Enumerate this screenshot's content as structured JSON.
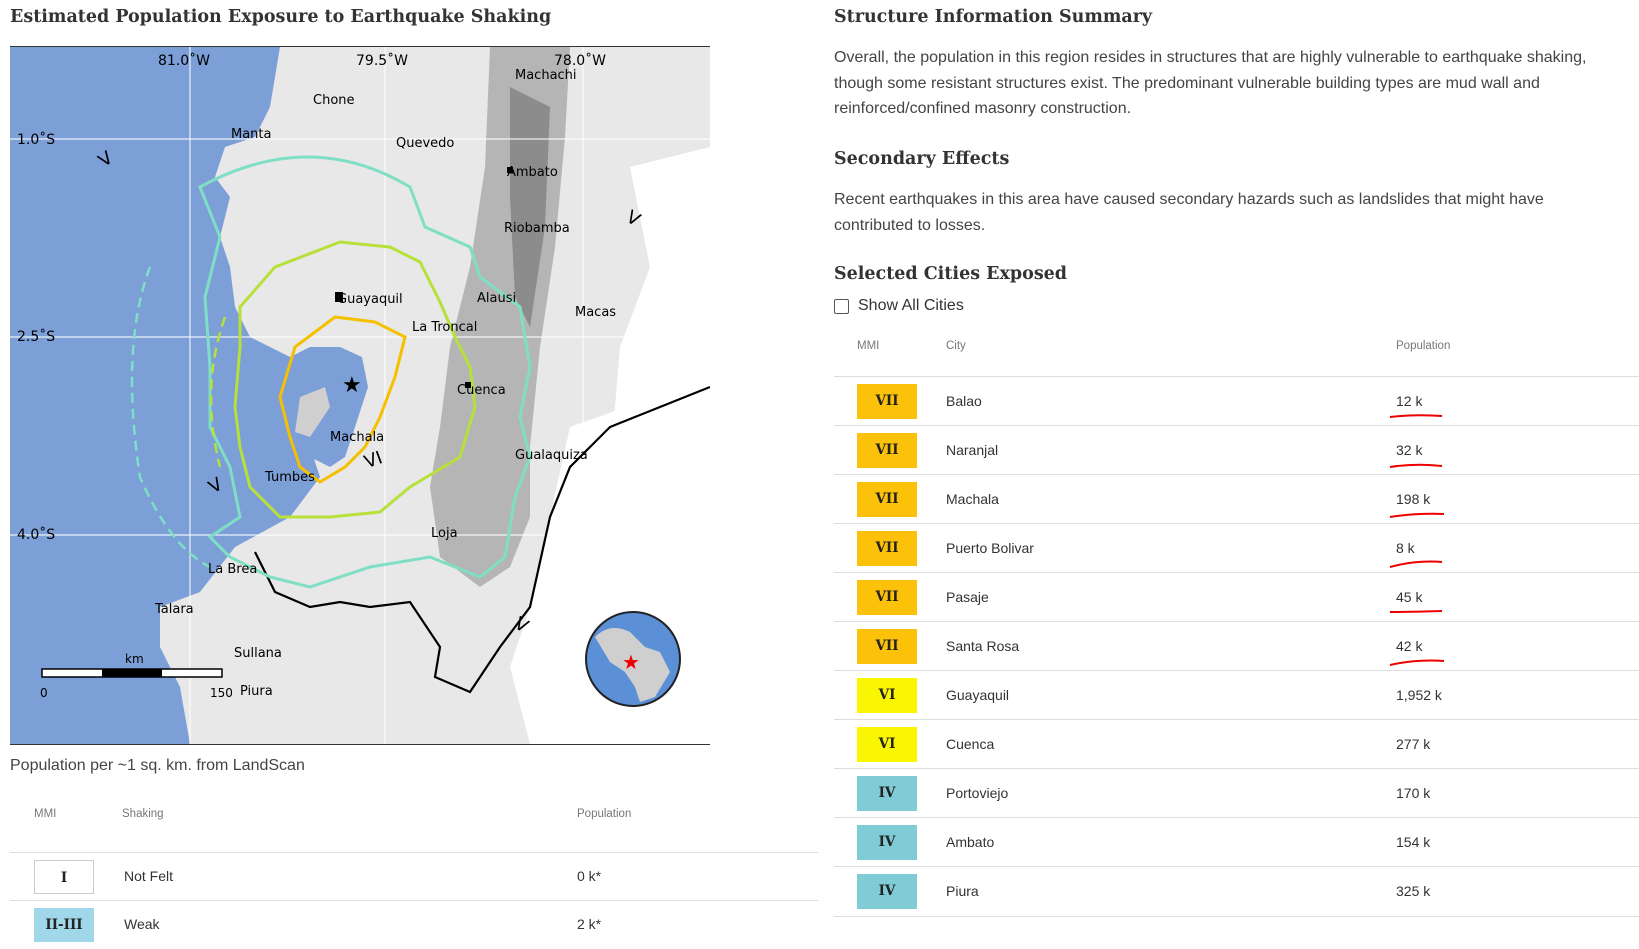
{
  "map_section": {
    "title": "Estimated Population Exposure to Earthquake Shaking",
    "caption": "Population per ~1 sq. km. from LandScan",
    "lon_labels": [
      "81.0˚W",
      "79.5˚W",
      "78.0˚W"
    ],
    "lat_labels": [
      "1.0˚S",
      "2.5˚S",
      "4.0˚S"
    ],
    "places": [
      "Machachi",
      "Chone",
      "Manta",
      "Quevedo",
      "Ambato",
      "Riobamba",
      "Guayaquil",
      "Alausi",
      "Macas",
      "La Troncal",
      "Cuenca",
      "Machala",
      "Gualaquiza",
      "Tumbes",
      "Loja",
      "La Brea",
      "Talara",
      "Sullana",
      "Piura"
    ],
    "contour_labels": [
      "V",
      "V",
      "V",
      "V",
      "VI"
    ],
    "scale": {
      "unit": "km",
      "start": "0",
      "end": "150"
    }
  },
  "shaking_table": {
    "headers": {
      "mmi": "MMI",
      "shaking": "Shaking",
      "population": "Population"
    },
    "rows": [
      {
        "mmi": "I",
        "shaking": "Not Felt",
        "population": "0 k*",
        "color": "#ffffff"
      },
      {
        "mmi": "II-III",
        "shaking": "Weak",
        "population": "2 k*",
        "color": "#a0d8ea"
      }
    ]
  },
  "structure": {
    "title": "Structure Information Summary",
    "text_lines": [
      "Overall, the population in this region resides in structures that are highly vulnerable to earthquake shaking,",
      "though some resistant structures exist. The predominant vulnerable building types are mud wall and",
      "reinforced/confined masonry construction."
    ]
  },
  "secondary": {
    "title": "Secondary Effects",
    "text_lines": [
      "Recent earthquakes in this area have caused secondary hazards such as landslides that might have",
      "contributed to losses."
    ]
  },
  "cities": {
    "title": "Selected Cities Exposed",
    "show_all_label": "Show All Cities",
    "headers": {
      "mmi": "MMI",
      "city": "City",
      "population": "Population"
    },
    "rows": [
      {
        "mmi": "VII",
        "city": "Balao",
        "population": "12 k",
        "color": "#fcc20a"
      },
      {
        "mmi": "VII",
        "city": "Naranjal",
        "population": "32 k",
        "color": "#fcc20a"
      },
      {
        "mmi": "VII",
        "city": "Machala",
        "population": "198 k",
        "color": "#fcc20a"
      },
      {
        "mmi": "VII",
        "city": "Puerto Bolivar",
        "population": "8 k",
        "color": "#fcc20a"
      },
      {
        "mmi": "VII",
        "city": "Pasaje",
        "population": "45 k",
        "color": "#fcc20a"
      },
      {
        "mmi": "VII",
        "city": "Santa Rosa",
        "population": "42 k",
        "color": "#fcc20a"
      },
      {
        "mmi": "VI",
        "city": "Guayaquil",
        "population": "1,952 k",
        "color": "#faf500"
      },
      {
        "mmi": "VI",
        "city": "Cuenca",
        "population": "277 k",
        "color": "#faf500"
      },
      {
        "mmi": "IV",
        "city": "Portoviejo",
        "population": "170 k",
        "color": "#7fcbd6"
      },
      {
        "mmi": "IV",
        "city": "Ambato",
        "population": "154 k",
        "color": "#7fcbd6"
      },
      {
        "mmi": "IV",
        "city": "Piura",
        "population": "325 k",
        "color": "#7fcbd6"
      }
    ]
  }
}
